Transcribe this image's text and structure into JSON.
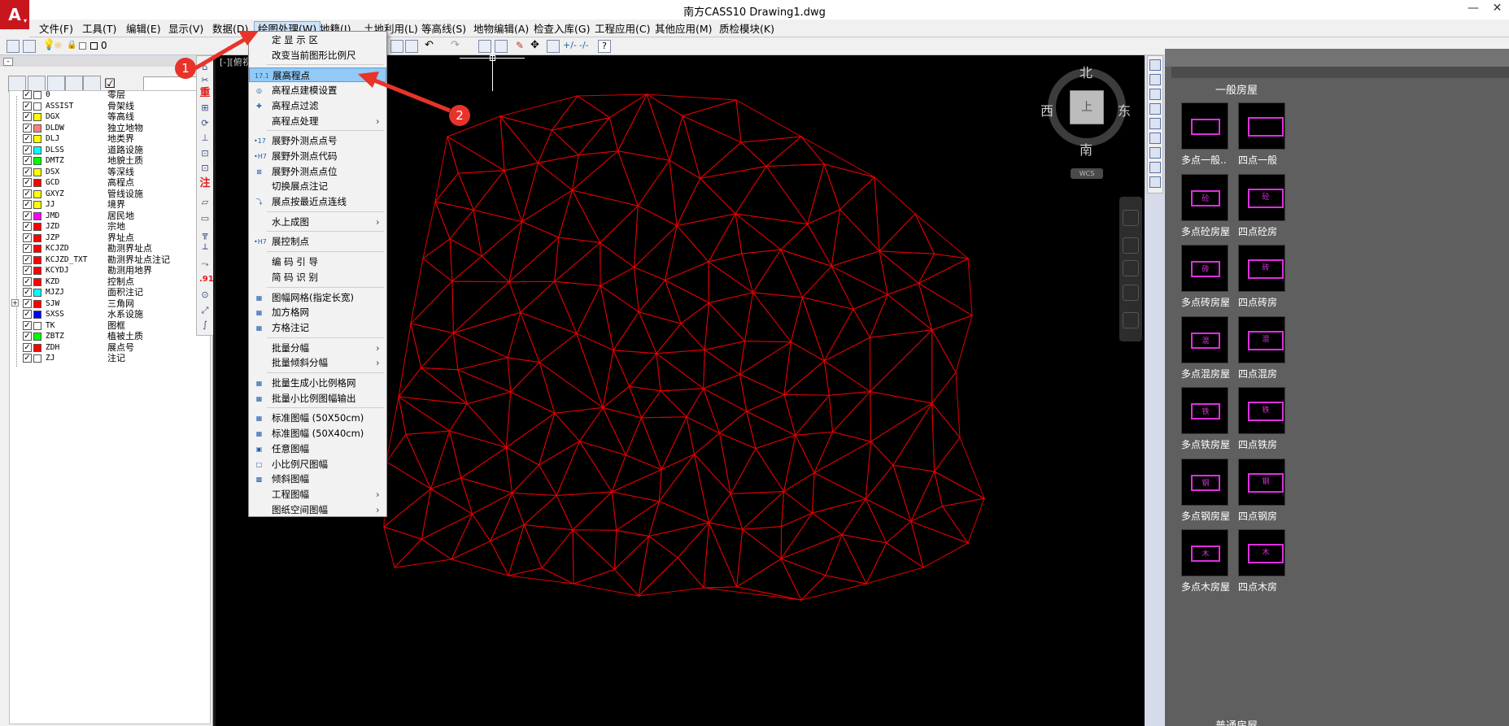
{
  "window": {
    "title": "南方CASS10    Drawing1.dwg",
    "logo_glyph": "A",
    "minimize": "—",
    "close": "✕"
  },
  "menubar": [
    "文件(F)",
    "工具(T)",
    "编辑(E)",
    "显示(V)",
    "数据(D)",
    "绘图处理(W)",
    "地籍(J)",
    "土地利用(L)",
    "等高线(S)",
    "地物编辑(A)",
    "检查入库(G)",
    "工程应用(C)",
    "其他应用(M)",
    "质检模块(K)"
  ],
  "toolbar": {
    "current_layer": "0"
  },
  "viewport_label": "[-][俯视",
  "layers": [
    {
      "code": "0",
      "name": "零层",
      "color": "#ffffff"
    },
    {
      "code": "ASSIST",
      "name": "骨架线",
      "color": "#ffffff"
    },
    {
      "code": "DGX",
      "name": "等高线",
      "color": "#ffff00"
    },
    {
      "code": "DLDW",
      "name": "独立地物",
      "color": "#ff8080"
    },
    {
      "code": "DLJ",
      "name": "地类界",
      "color": "#ffff00"
    },
    {
      "code": "DLSS",
      "name": "道路设施",
      "color": "#00ffff"
    },
    {
      "code": "DMTZ",
      "name": "地貌土质",
      "color": "#00ff00"
    },
    {
      "code": "DSX",
      "name": "等深线",
      "color": "#ffff00"
    },
    {
      "code": "GCD",
      "name": "高程点",
      "color": "#ff0000"
    },
    {
      "code": "GXYZ",
      "name": "管线设施",
      "color": "#ffff00"
    },
    {
      "code": "JJ",
      "name": "境界",
      "color": "#ffff00"
    },
    {
      "code": "JMD",
      "name": "居民地",
      "color": "#ff00ff"
    },
    {
      "code": "JZD",
      "name": "宗地",
      "color": "#ff0000"
    },
    {
      "code": "JZP",
      "name": "界址点",
      "color": "#ff0000"
    },
    {
      "code": "KCJZD",
      "name": "勘测界址点",
      "color": "#ff0000"
    },
    {
      "code": "KCJZD_TXT",
      "name": "勘测界址点注记",
      "color": "#ff0000"
    },
    {
      "code": "KCYDJ",
      "name": "勘测用地界",
      "color": "#ff0000"
    },
    {
      "code": "KZD",
      "name": "控制点",
      "color": "#ff0000"
    },
    {
      "code": "MJZJ",
      "name": "面积注记",
      "color": "#00ffff"
    },
    {
      "code": "SJW",
      "name": "三角网",
      "color": "#ff0000"
    },
    {
      "code": "SXSS",
      "name": "水系设施",
      "color": "#0000ff"
    },
    {
      "code": "TK",
      "name": "图框",
      "color": "#ffffff"
    },
    {
      "code": "ZBTZ",
      "name": "植被土质",
      "color": "#00ff00"
    },
    {
      "code": "ZDH",
      "name": "展点号",
      "color": "#ff0000"
    },
    {
      "code": "ZJ",
      "name": "注记",
      "color": "#ffffff"
    }
  ],
  "vstrip_labels": {
    "heavy": "重",
    "note": "注",
    "num": ".91"
  },
  "dropdown": [
    {
      "label": "定 显 示 区",
      "icon": "",
      "sub": false,
      "sep_before": false
    },
    {
      "label": "改变当前图形比例尺",
      "icon": "",
      "sub": false,
      "sep_before": false
    },
    {
      "label": "展高程点",
      "icon": "17.1",
      "sub": false,
      "sep_before": true,
      "highlighted": true
    },
    {
      "label": "高程点建模设置",
      "icon": "◎",
      "sub": false,
      "sep_before": false
    },
    {
      "label": "高程点过滤",
      "icon": "✚",
      "sub": false,
      "sep_before": false
    },
    {
      "label": "高程点处理",
      "icon": "",
      "sub": true,
      "sep_before": false
    },
    {
      "label": "展野外测点点号",
      "icon": "•17",
      "sub": false,
      "sep_before": true
    },
    {
      "label": "展野外测点代码",
      "icon": "•H7",
      "sub": false,
      "sep_before": false
    },
    {
      "label": "展野外测点点位",
      "icon": "⊠",
      "sub": false,
      "sep_before": false
    },
    {
      "label": "切换展点注记",
      "icon": "",
      "sub": false,
      "sep_before": false
    },
    {
      "label": "展点按最近点连线",
      "icon": "⤵",
      "sub": false,
      "sep_before": false
    },
    {
      "label": "水上成图",
      "icon": "",
      "sub": true,
      "sep_before": true
    },
    {
      "label": "展控制点",
      "icon": "•H7",
      "sub": false,
      "sep_before": true
    },
    {
      "label": "编 码 引 导",
      "icon": "",
      "sub": false,
      "sep_before": true
    },
    {
      "label": "简 码 识 别",
      "icon": "",
      "sub": false,
      "sep_before": false
    },
    {
      "label": "图幅网格(指定长宽)",
      "icon": "▦",
      "sub": false,
      "sep_before": true
    },
    {
      "label": "加方格网",
      "icon": "▦",
      "sub": false,
      "sep_before": false
    },
    {
      "label": "方格注记",
      "icon": "▦",
      "sub": false,
      "sep_before": false
    },
    {
      "label": "批量分幅",
      "icon": "",
      "sub": true,
      "sep_before": true
    },
    {
      "label": "批量倾斜分幅",
      "icon": "",
      "sub": true,
      "sep_before": false
    },
    {
      "label": "批量生成小比例格网",
      "icon": "▦",
      "sub": false,
      "sep_before": true
    },
    {
      "label": "批量小比例图幅输出",
      "icon": "▦",
      "sub": false,
      "sep_before": false
    },
    {
      "label": "标准图幅 (50X50cm)",
      "icon": "▦",
      "sub": false,
      "sep_before": true
    },
    {
      "label": "标准图幅 (50X40cm)",
      "icon": "▦",
      "sub": false,
      "sep_before": false
    },
    {
      "label": "任意图幅",
      "icon": "▣",
      "sub": false,
      "sep_before": false
    },
    {
      "label": "小比例尺图幅",
      "icon": "□",
      "sub": false,
      "sep_before": false
    },
    {
      "label": "倾斜图幅",
      "icon": "▩",
      "sub": false,
      "sep_before": false
    },
    {
      "label": "工程图幅",
      "icon": "",
      "sub": true,
      "sep_before": false
    },
    {
      "label": "图纸空间图幅",
      "icon": "",
      "sub": true,
      "sep_before": false
    }
  ],
  "viewcube": {
    "north": "北",
    "south": "南",
    "east": "东",
    "west": "西",
    "face": "上",
    "wcs": "WCS"
  },
  "palette": {
    "title": "一般房屋",
    "footer": "普通房屋",
    "items": [
      {
        "label": "多点一般..",
        "tag": ""
      },
      {
        "label": "四点一般",
        "tag": ""
      },
      {
        "label": "多点砼房屋",
        "tag": "砼"
      },
      {
        "label": "四点砼房",
        "tag": "砼"
      },
      {
        "label": "多点砖房屋",
        "tag": "砖"
      },
      {
        "label": "四点砖房",
        "tag": "砖"
      },
      {
        "label": "多点混房屋",
        "tag": "混"
      },
      {
        "label": "四点混房",
        "tag": "混"
      },
      {
        "label": "多点铁房屋",
        "tag": "铁"
      },
      {
        "label": "四点铁房",
        "tag": "铁"
      },
      {
        "label": "多点钢房屋",
        "tag": "钢"
      },
      {
        "label": "四点钢房",
        "tag": "钢"
      },
      {
        "label": "多点木房屋",
        "tag": "木"
      },
      {
        "label": "四点木房",
        "tag": "木"
      }
    ]
  },
  "annotations": {
    "step1": "1",
    "step2": "2"
  },
  "colors": {
    "tin_line": "#e00000",
    "annotation": "#e8332a",
    "highlight": "#91c9f7"
  }
}
